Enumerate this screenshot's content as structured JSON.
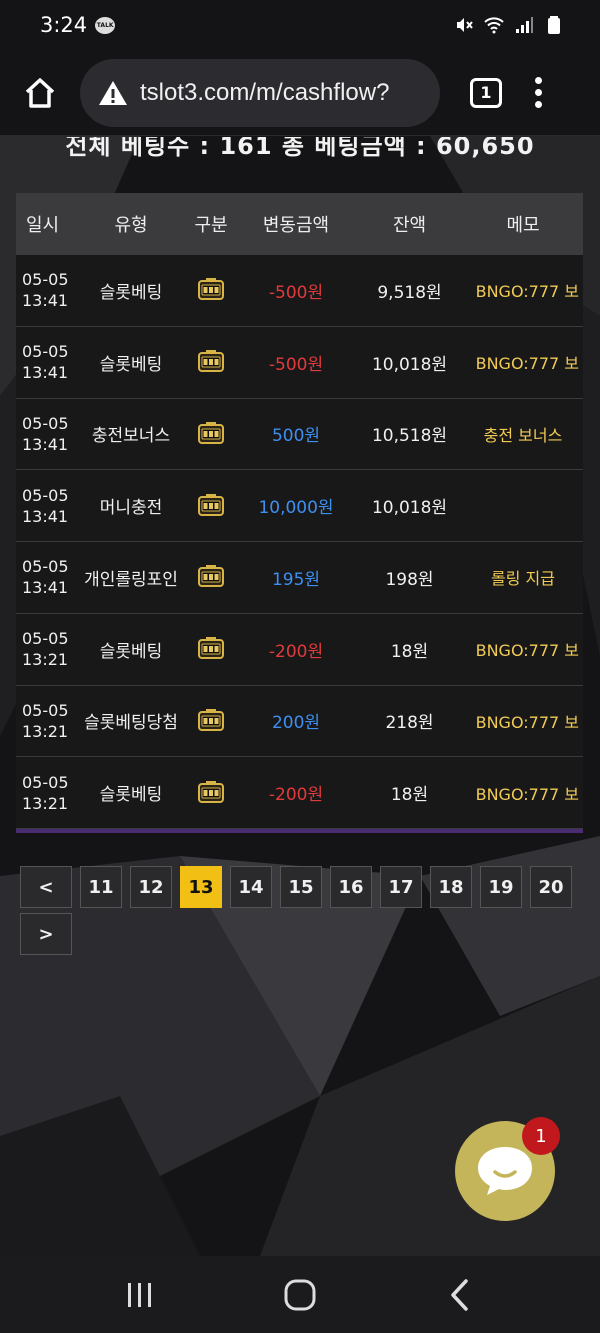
{
  "status_bar": {
    "time": "3:24",
    "talk_badge": "TALK",
    "icons": [
      "mute-icon",
      "wifi-icon",
      "signal-icon",
      "battery-icon"
    ]
  },
  "browser": {
    "url": "tslot3.com/m/cashflow?",
    "tab_count": "1"
  },
  "summary": {
    "text": "전체 베팅수 : 161   총 베팅금액 : 60,650"
  },
  "table": {
    "headers": [
      "일시",
      "유형",
      "구분",
      "변동금액",
      "잔액",
      "메모"
    ],
    "rows": [
      {
        "date": "05-05",
        "time": "13:41",
        "type": "슬롯베팅",
        "amount": "-500원",
        "sign": "neg",
        "balance": "9,518원",
        "memo": "BNGO:777 보"
      },
      {
        "date": "05-05",
        "time": "13:41",
        "type": "슬롯베팅",
        "amount": "-500원",
        "sign": "neg",
        "balance": "10,018원",
        "memo": "BNGO:777 보"
      },
      {
        "date": "05-05",
        "time": "13:41",
        "type": "충전보너스",
        "amount": "500원",
        "sign": "pos",
        "balance": "10,518원",
        "memo": "충전 보너스"
      },
      {
        "date": "05-05",
        "time": "13:41",
        "type": "머니충전",
        "amount": "10,000원",
        "sign": "pos",
        "balance": "10,018원",
        "memo": ""
      },
      {
        "date": "05-05",
        "time": "13:41",
        "type": "개인롤링포인",
        "amount": "195원",
        "sign": "pos",
        "balance": "198원",
        "memo": "롤링 지급"
      },
      {
        "date": "05-05",
        "time": "13:21",
        "type": "슬롯베팅",
        "amount": "-200원",
        "sign": "neg",
        "balance": "18원",
        "memo": "BNGO:777 보"
      },
      {
        "date": "05-05",
        "time": "13:21",
        "type": "슬롯베팅당첨",
        "amount": "200원",
        "sign": "pos",
        "balance": "218원",
        "memo": "BNGO:777 보"
      },
      {
        "date": "05-05",
        "time": "13:21",
        "type": "슬롯베팅",
        "amount": "-200원",
        "sign": "neg",
        "balance": "18원",
        "memo": "BNGO:777 보"
      }
    ]
  },
  "pagination": {
    "prev": "<",
    "next": ">",
    "pages": [
      "11",
      "12",
      "13",
      "14",
      "15",
      "16",
      "17",
      "18",
      "19",
      "20"
    ],
    "current": "13"
  },
  "chat": {
    "badge_count": "1"
  },
  "colors": {
    "negative": "#e03a3a",
    "positive": "#3d8ff0",
    "memo": "#f2cb55",
    "active_page": "#f2c014",
    "chat_button": "#c4b45a",
    "badge": "#c0181c"
  }
}
